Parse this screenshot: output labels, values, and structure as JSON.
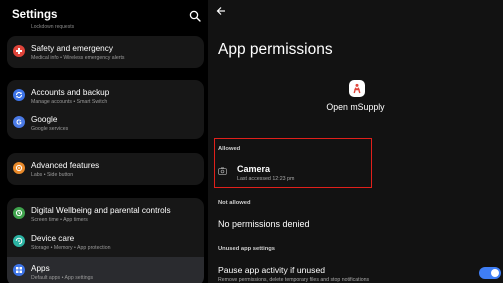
{
  "left": {
    "title": "Settings",
    "cut_text": "Lockdown requests",
    "groups": [
      {
        "items": [
          {
            "title": "Safety and emergency",
            "sub": "Medical info  •  Wireless emergency alerts",
            "color": "#e0443a",
            "icon": "safety-icon"
          }
        ]
      },
      {
        "items": [
          {
            "title": "Accounts and backup",
            "sub": "Manage accounts  •  Smart Switch",
            "color": "#3d74e8",
            "icon": "sync-icon"
          },
          {
            "title": "Google",
            "sub": "Google services",
            "color": "#4a7ae6",
            "icon": "google-icon"
          }
        ]
      },
      {
        "items": [
          {
            "title": "Advanced features",
            "sub": "Labs  •  Side button",
            "color": "#ea8a2a",
            "icon": "gear-star-icon"
          }
        ]
      },
      {
        "items": [
          {
            "title": "Digital Wellbeing and parental controls",
            "sub": "Screen time  •  App timers",
            "color": "#3fa34d",
            "icon": "wellbeing-icon"
          },
          {
            "title": "Device care",
            "sub": "Storage  •  Memory  •  App protection",
            "color": "#2bb3a3",
            "icon": "device-care-icon"
          },
          {
            "title": "Apps",
            "sub": "Default apps  •  App settings",
            "color": "#3d74e8",
            "icon": "apps-grid-icon",
            "selected": true
          }
        ]
      }
    ]
  },
  "right": {
    "title": "App permissions",
    "app_name": "Open mSupply",
    "allowed_label": "Allowed",
    "permission": {
      "title": "Camera",
      "sub": "Last accessed 12:23 pm"
    },
    "not_allowed_label": "Not allowed",
    "not_allowed_text": "No permissions denied",
    "unused_label": "Unused app settings",
    "pause": {
      "title": "Pause app activity if unused",
      "sub": "Remove permissions, delete temporary files and stop notifications",
      "enabled": true
    },
    "accent": "#3f7ef5",
    "highlight_color": "#e0201b"
  }
}
